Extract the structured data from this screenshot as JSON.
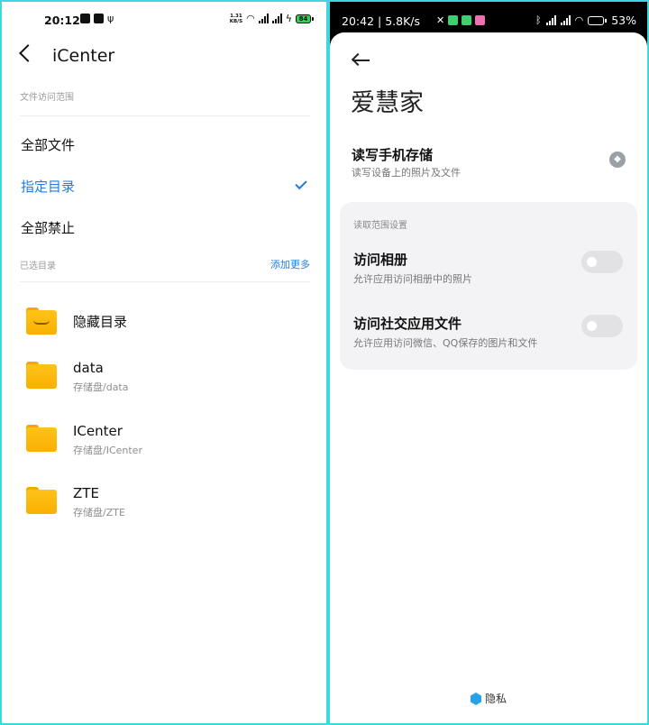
{
  "left": {
    "status_bar": {
      "time": "20:12",
      "speed_value": "1.31",
      "speed_unit": "KB/S",
      "battery": "84"
    },
    "header": {
      "title": "iCenter"
    },
    "access_scope": {
      "label": "文件访问范围",
      "options": [
        {
          "label": "全部文件",
          "selected": false
        },
        {
          "label": "指定目录",
          "selected": true
        },
        {
          "label": "全部禁止",
          "selected": false
        }
      ]
    },
    "selected_dirs": {
      "label": "已选目录",
      "add_more": "添加更多",
      "items": [
        {
          "name": "隐藏目录",
          "path": ""
        },
        {
          "name": "data",
          "path": "存储盘/data"
        },
        {
          "name": "ICenter",
          "path": "存储盘/ICenter"
        },
        {
          "name": "ZTE",
          "path": "存储盘/ZTE"
        }
      ]
    }
  },
  "right": {
    "status_bar": {
      "time": "20:42",
      "speed": "5.8K/s",
      "battery": "53%"
    },
    "header": {
      "title": "爱慧家"
    },
    "storage_perm": {
      "title": "读写手机存储",
      "subtitle": "读写设备上的照片及文件"
    },
    "scope_card": {
      "label": "读取范围设置",
      "rows": [
        {
          "title": "访问相册",
          "subtitle": "允许应用访问相册中的照片",
          "enabled": false
        },
        {
          "title": "访问社交应用文件",
          "subtitle": "允许应用访问微信、QQ保存的图片和文件",
          "enabled": false
        }
      ]
    },
    "footer": {
      "brand": "隐私"
    }
  }
}
